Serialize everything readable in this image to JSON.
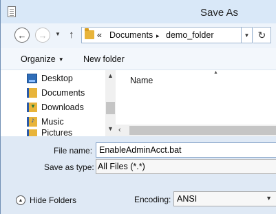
{
  "window": {
    "title": "Save As"
  },
  "nav": {
    "address_prefix": "«",
    "address_segments": [
      "Documents",
      "demo_folder"
    ],
    "separator": "▸"
  },
  "toolbar": {
    "organize_label": "Organize",
    "new_folder_label": "New folder"
  },
  "tree": {
    "items": [
      {
        "label": "Desktop",
        "icon": "desktop-icon"
      },
      {
        "label": "Documents",
        "icon": "documents-folder-icon"
      },
      {
        "label": "Downloads",
        "icon": "downloads-folder-icon"
      },
      {
        "label": "Music",
        "icon": "music-folder-icon"
      },
      {
        "label": "Pictures",
        "icon": "pictures-folder-icon"
      }
    ]
  },
  "filelist": {
    "column_name": "Name"
  },
  "form": {
    "file_name_label": "File name:",
    "file_name_value": "EnableAdminAcct.bat",
    "save_as_type_label": "Save as type:",
    "save_as_type_value": "All Files  (*.*)",
    "hide_folders_label": "Hide Folders",
    "encoding_label": "Encoding:",
    "encoding_value": "ANSI"
  },
  "colors": {
    "title_bg": "#d9e8f8",
    "form_bg": "#dfe9f5",
    "folder": "#e8b43a"
  }
}
